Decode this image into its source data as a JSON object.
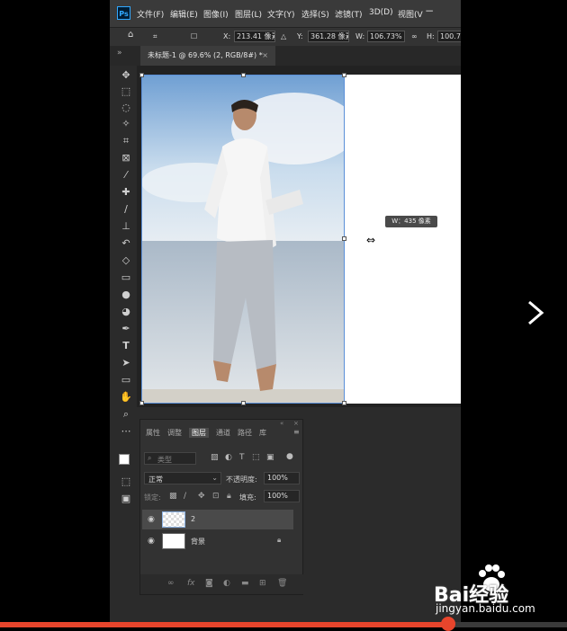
{
  "app": {
    "logo": "Ps"
  },
  "menu": [
    "文件(F)",
    "编辑(E)",
    "图像(I)",
    "图层(L)",
    "文字(Y)",
    "选择(S)",
    "滤镜(T)",
    "3D(D)",
    "视图(V"
  ],
  "options": {
    "x_label": "X:",
    "x_value": "213.41 像素",
    "delta_label": "△",
    "y_label": "Y:",
    "y_value": "361.28 像素",
    "w_label": "W:",
    "w_value": "106.73%",
    "h_label": "H:",
    "h_value": "100.7"
  },
  "document_tab": {
    "title": "未标题-1 @ 69.6% (2, RGB/8#) *",
    "close": "×"
  },
  "tooltip": {
    "text": "W：435 像素"
  },
  "layers_panel": {
    "tabs": [
      "属性",
      "调整",
      "图层",
      "通道",
      "路径",
      "库"
    ],
    "active_tab": "图层",
    "filter_placeholder": "类型",
    "blend_mode": "正常",
    "opacity_label": "不透明度:",
    "opacity_value": "100%",
    "lock_label": "锁定:",
    "fill_label": "填充:",
    "fill_value": "100%",
    "layers": [
      {
        "name": "2",
        "selected": true
      },
      {
        "name": "背景",
        "selected": false,
        "locked": true
      }
    ]
  },
  "watermark": {
    "brand": "Bai经验",
    "url": "jingyan.baidu.com"
  },
  "video_progress": {
    "played_fraction": 0.79
  },
  "colors": {
    "accent": "#e8452c",
    "selection": "#5a8fd8",
    "ps_blue": "#31a8ff"
  }
}
